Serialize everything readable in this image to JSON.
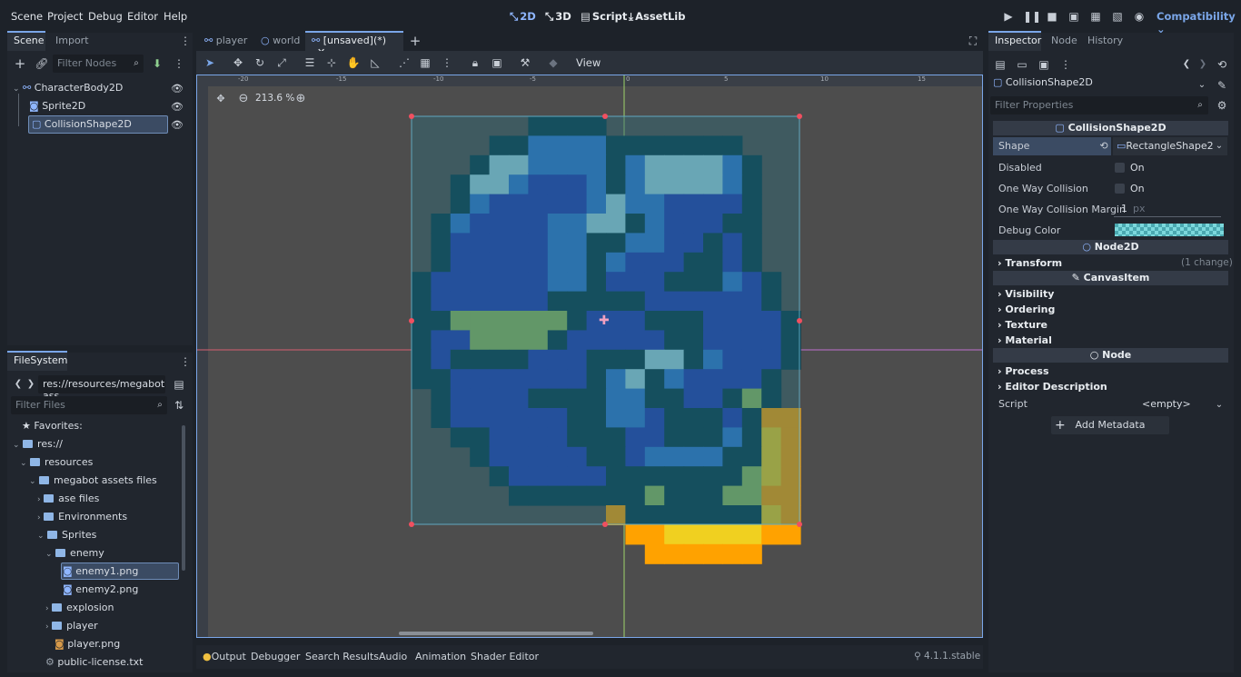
{
  "menu": [
    "Scene",
    "Project",
    "Debug",
    "Editor",
    "Help"
  ],
  "workspaces": {
    "w2d": "2D",
    "w3d": "3D",
    "script": "Script",
    "assetlib": "AssetLib"
  },
  "renderer": "Compatibility",
  "scene_panel": {
    "tabs": [
      "Scene",
      "Import"
    ],
    "filter_placeholder": "Filter Nodes",
    "nodes": [
      "CharacterBody2D",
      "Sprite2D",
      "CollisionShape2D"
    ]
  },
  "filesystem": {
    "tab": "FileSystem",
    "path": "res://resources/megabot ass",
    "filter_placeholder": "Filter Files",
    "items": [
      "Favorites:",
      "res://",
      "resources",
      "megabot assets files",
      "ase files",
      "Environments",
      "Sprites",
      "enemy",
      "enemy1.png",
      "enemy2.png",
      "explosion",
      "player",
      "player.png",
      "public-license.txt"
    ]
  },
  "editor_tabs": [
    "player",
    "world",
    "[unsaved](*)"
  ],
  "toolbar": {
    "view": "View"
  },
  "viewport": {
    "zoom": "213.6 %"
  },
  "ruler_labels": [
    "-20",
    "-15",
    "-10",
    "-5",
    "0",
    "5",
    "10",
    "15"
  ],
  "bottom_tabs": [
    "Output",
    "Debugger",
    "Search Results",
    "Audio",
    "Animation",
    "Shader Editor"
  ],
  "version": "4.1.1.stable",
  "inspector": {
    "tabs": [
      "Inspector",
      "Node",
      "History"
    ],
    "object": "CollisionShape2D",
    "filter_placeholder": "Filter Properties",
    "section_collision": "CollisionShape2D",
    "shape_label": "Shape",
    "shape_value": "RectangleShape2",
    "disabled_label": "Disabled",
    "disabled_value": "On",
    "oneway_label": "One Way Collision",
    "oneway_value": "On",
    "margin_label": "One Way Collision Margin",
    "margin_value": "1",
    "margin_unit": "px",
    "debug_color_label": "Debug Color",
    "section_node2d": "Node2D",
    "transform": "Transform",
    "transform_note": "(1 change)",
    "section_canvas": "CanvasItem",
    "visibility": "Visibility",
    "ordering": "Ordering",
    "texture": "Texture",
    "material": "Material",
    "section_node": "Node",
    "process": "Process",
    "editor_description": "Editor Description",
    "script_label": "Script",
    "script_value": "<empty>",
    "add_metadata": "Add Metadata"
  },
  "colors": {
    "accent": "#7aa6e8",
    "shape_fill": "#2e6a78",
    "bg_dark": "#1d2229",
    "panel": "#21262e"
  }
}
